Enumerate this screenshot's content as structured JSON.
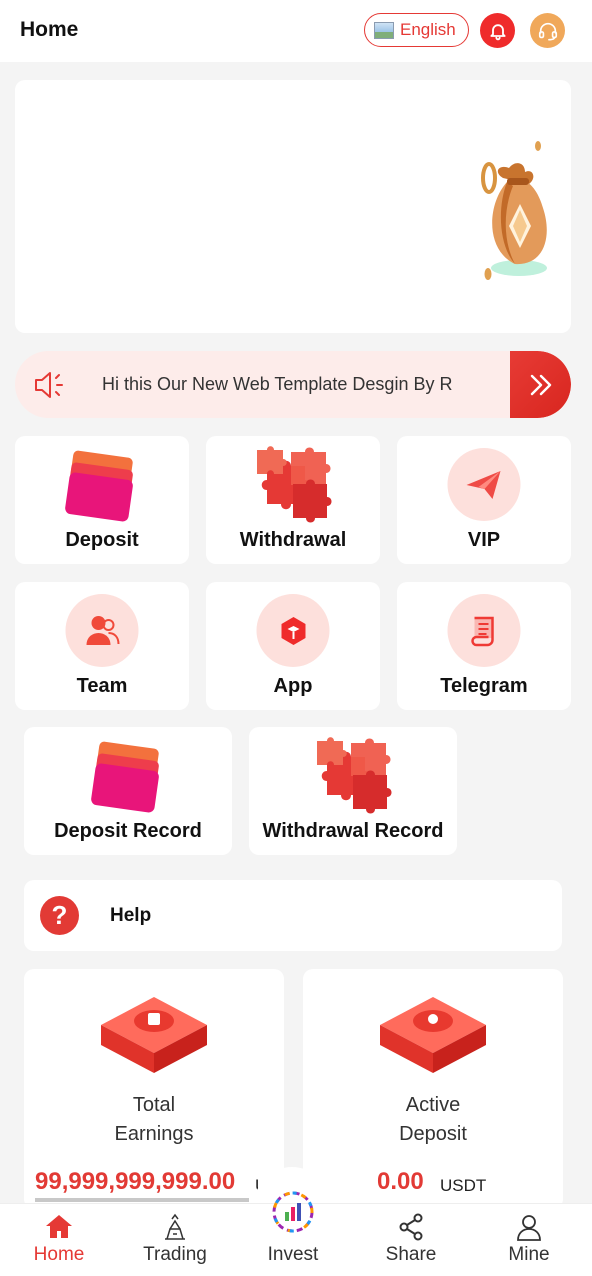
{
  "header": {
    "title": "Home",
    "language_label": "English"
  },
  "notice": {
    "text": "Hi this Our New Web Template Desgin By R"
  },
  "quick_actions": [
    {
      "label": "Deposit",
      "icon": "wallet-cards-icon"
    },
    {
      "label": "Withdrawal",
      "icon": "puzzle-icon"
    },
    {
      "label": "VIP",
      "icon": "paper-plane-icon"
    },
    {
      "label": "Team",
      "icon": "users-icon"
    },
    {
      "label": "App",
      "icon": "cube-icon"
    },
    {
      "label": "Telegram",
      "icon": "scroll-icon"
    },
    {
      "label": "Deposit Record",
      "icon": "wallet-cards-icon"
    },
    {
      "label": "Withdrawal Record",
      "icon": "puzzle-icon"
    }
  ],
  "help": {
    "label": "Help"
  },
  "stats": [
    {
      "caption_line1": "Total",
      "caption_line2": "Earnings",
      "value": "99,999,999,999.00",
      "unit": "USDT"
    },
    {
      "caption_line1": "Active",
      "caption_line2": "Deposit",
      "value": "0.00",
      "unit": "USDT"
    }
  ],
  "nav": [
    {
      "label": "Home",
      "icon": "home-icon",
      "active": true
    },
    {
      "label": "Trading",
      "icon": "trading-icon",
      "active": false
    },
    {
      "label": "Invest",
      "icon": "invest-icon",
      "active": false
    },
    {
      "label": "Share",
      "icon": "share-icon",
      "active": false
    },
    {
      "label": "Mine",
      "icon": "user-icon",
      "active": false
    }
  ],
  "colors": {
    "accent": "#e53935",
    "page_bg": "#f4f4f4",
    "notice_bg": "#fdecea",
    "support": "#f0a85a"
  }
}
